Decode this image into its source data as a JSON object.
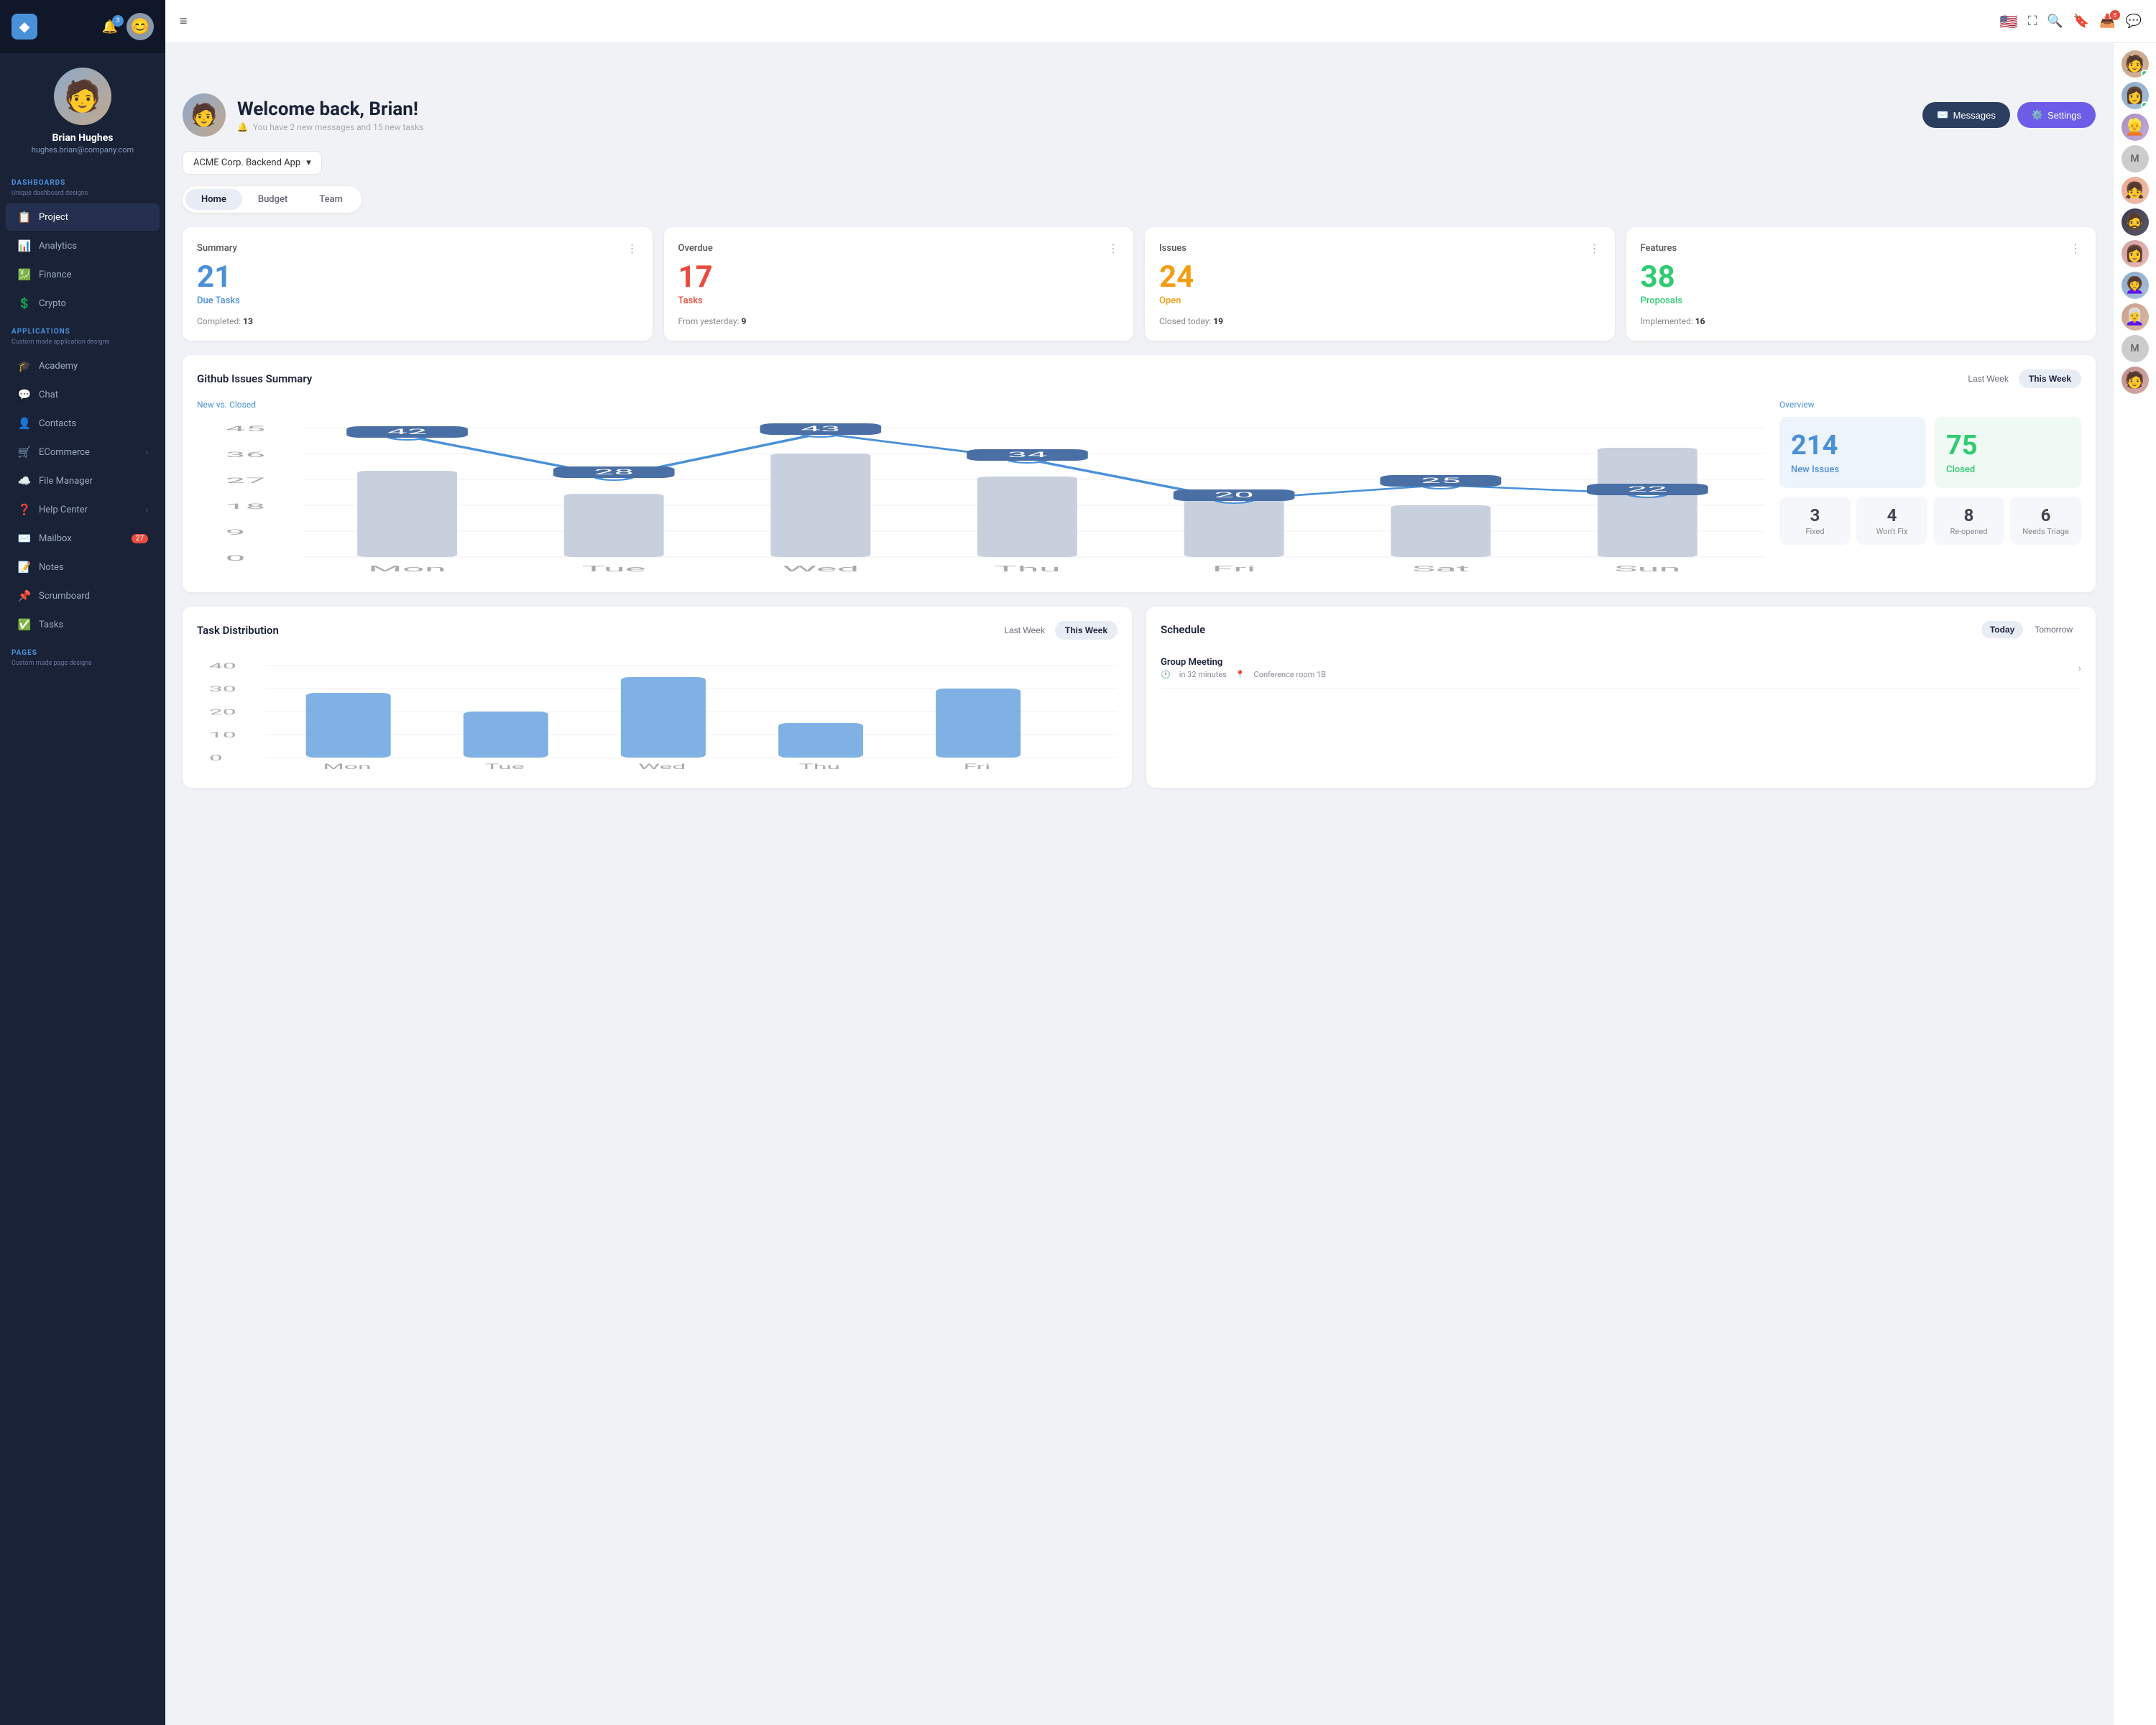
{
  "sidebar": {
    "logo": "◆",
    "notification_count": "3",
    "profile": {
      "name": "Brian Hughes",
      "email": "hughes.brian@company.com"
    },
    "dashboards_label": "DASHBOARDS",
    "dashboards_sub": "Unique dashboard designs",
    "nav_items": [
      {
        "id": "project",
        "label": "Project",
        "icon": "📋",
        "active": true
      },
      {
        "id": "analytics",
        "label": "Analytics",
        "icon": "📊"
      },
      {
        "id": "finance",
        "label": "Finance",
        "icon": "💹"
      },
      {
        "id": "crypto",
        "label": "Crypto",
        "icon": "💲"
      }
    ],
    "applications_label": "APPLICATIONS",
    "applications_sub": "Custom made application designs",
    "app_items": [
      {
        "id": "academy",
        "label": "Academy",
        "icon": "🎓"
      },
      {
        "id": "chat",
        "label": "Chat",
        "icon": "💬"
      },
      {
        "id": "contacts",
        "label": "Contacts",
        "icon": "👤"
      },
      {
        "id": "ecommerce",
        "label": "ECommerce",
        "icon": "🛒",
        "has_arrow": true
      },
      {
        "id": "filemanager",
        "label": "File Manager",
        "icon": "☁️"
      },
      {
        "id": "helpcenter",
        "label": "Help Center",
        "icon": "❓",
        "has_arrow": true
      },
      {
        "id": "mailbox",
        "label": "Mailbox",
        "icon": "✉️",
        "badge": "27"
      },
      {
        "id": "notes",
        "label": "Notes",
        "icon": "📝"
      },
      {
        "id": "scrumboard",
        "label": "Scrumboard",
        "icon": "📌"
      },
      {
        "id": "tasks",
        "label": "Tasks",
        "icon": "✅"
      }
    ],
    "pages_label": "PAGES",
    "pages_sub": "Custom made page designs"
  },
  "topbar": {
    "hamburger_icon": "≡",
    "flag": "🇺🇸",
    "fullscreen_icon": "⛶",
    "search_icon": "🔍",
    "bookmark_icon": "🔖",
    "inbox_icon": "📥",
    "inbox_badge": "5",
    "chat_icon": "💬"
  },
  "right_sidebar": {
    "avatars": [
      {
        "id": "rs-1",
        "initials": "",
        "color": "#c0a88f",
        "online": true
      },
      {
        "id": "rs-2",
        "initials": "",
        "color": "#8fa8c8",
        "online": true
      },
      {
        "id": "rs-3",
        "initials": "",
        "color": "#a88fc0",
        "online": false
      },
      {
        "id": "rs-4",
        "initials": "M",
        "color": "#ccc",
        "online": false
      },
      {
        "id": "rs-5",
        "initials": "",
        "color": "#f0a890",
        "online": false
      },
      {
        "id": "rs-6",
        "initials": "",
        "color": "#3a3a3a",
        "online": false
      },
      {
        "id": "rs-7",
        "initials": "",
        "color": "#d4a0a0",
        "online": false
      },
      {
        "id": "rs-8",
        "initials": "",
        "color": "#8faac8",
        "online": false
      },
      {
        "id": "rs-9",
        "initials": "",
        "color": "#c8a08f",
        "online": false
      },
      {
        "id": "rs-10",
        "initials": "M",
        "color": "#ccc",
        "online": false
      },
      {
        "id": "rs-11",
        "initials": "",
        "color": "#c08f8f",
        "online": false
      }
    ]
  },
  "welcome": {
    "greeting": "Welcome back, Brian!",
    "subtitle": "You have 2 new messages and 15 new tasks",
    "messages_btn": "Messages",
    "settings_btn": "Settings"
  },
  "project_selector": {
    "label": "ACME Corp. Backend App"
  },
  "tabs": {
    "items": [
      {
        "id": "home",
        "label": "Home",
        "active": true
      },
      {
        "id": "budget",
        "label": "Budget"
      },
      {
        "id": "team",
        "label": "Team"
      }
    ]
  },
  "stats": [
    {
      "id": "summary",
      "title": "Summary",
      "number": "21",
      "number_color": "blue",
      "label": "Due Tasks",
      "footer_text": "Completed:",
      "footer_value": "13"
    },
    {
      "id": "overdue",
      "title": "Overdue",
      "number": "17",
      "number_color": "red",
      "label": "Tasks",
      "footer_text": "From yesterday:",
      "footer_value": "9"
    },
    {
      "id": "issues",
      "title": "Issues",
      "number": "24",
      "number_color": "orange",
      "label": "Open",
      "footer_text": "Closed today:",
      "footer_value": "19"
    },
    {
      "id": "features",
      "title": "Features",
      "number": "38",
      "number_color": "green",
      "label": "Proposals",
      "footer_text": "Implemented:",
      "footer_value": "16"
    }
  ],
  "github_issues": {
    "title": "Github Issues Summary",
    "last_week_label": "Last Week",
    "this_week_label": "This Week",
    "chart_sublabel": "New vs. Closed",
    "overview_label": "Overview",
    "chart_data": {
      "labels": [
        "Mon",
        "Tue",
        "Wed",
        "Thu",
        "Fri",
        "Sat",
        "Sun"
      ],
      "line_values": [
        42,
        28,
        43,
        34,
        20,
        25,
        22
      ],
      "bar_values": [
        30,
        22,
        36,
        28,
        20,
        18,
        38
      ]
    },
    "new_issues": "214",
    "new_issues_label": "New Issues",
    "closed": "75",
    "closed_label": "Closed",
    "mini_stats": [
      {
        "id": "fixed",
        "number": "3",
        "label": "Fixed"
      },
      {
        "id": "wont-fix",
        "number": "4",
        "label": "Won't Fix"
      },
      {
        "id": "reopened",
        "number": "8",
        "label": "Re-opened"
      },
      {
        "id": "needs-triage",
        "number": "6",
        "label": "Needs Triage"
      }
    ]
  },
  "task_distribution": {
    "title": "Task Distribution",
    "last_week_label": "Last Week",
    "this_week_label": "This Week",
    "bar_data": {
      "max_value": 40,
      "y_labels": [
        "40",
        "30",
        "20",
        "10",
        "0"
      ],
      "bars": [
        {
          "label": "Mon",
          "value": 28
        },
        {
          "label": "Tue",
          "value": 20
        },
        {
          "label": "Wed",
          "value": 35
        },
        {
          "label": "Thu",
          "value": 15
        },
        {
          "label": "Fri",
          "value": 30
        }
      ]
    }
  },
  "schedule": {
    "title": "Schedule",
    "today_label": "Today",
    "tomorrow_label": "Tomorrow",
    "items": [
      {
        "id": "group-meeting",
        "title": "Group Meeting",
        "time": "in 32 minutes",
        "location": "Conference room 1B"
      }
    ]
  }
}
